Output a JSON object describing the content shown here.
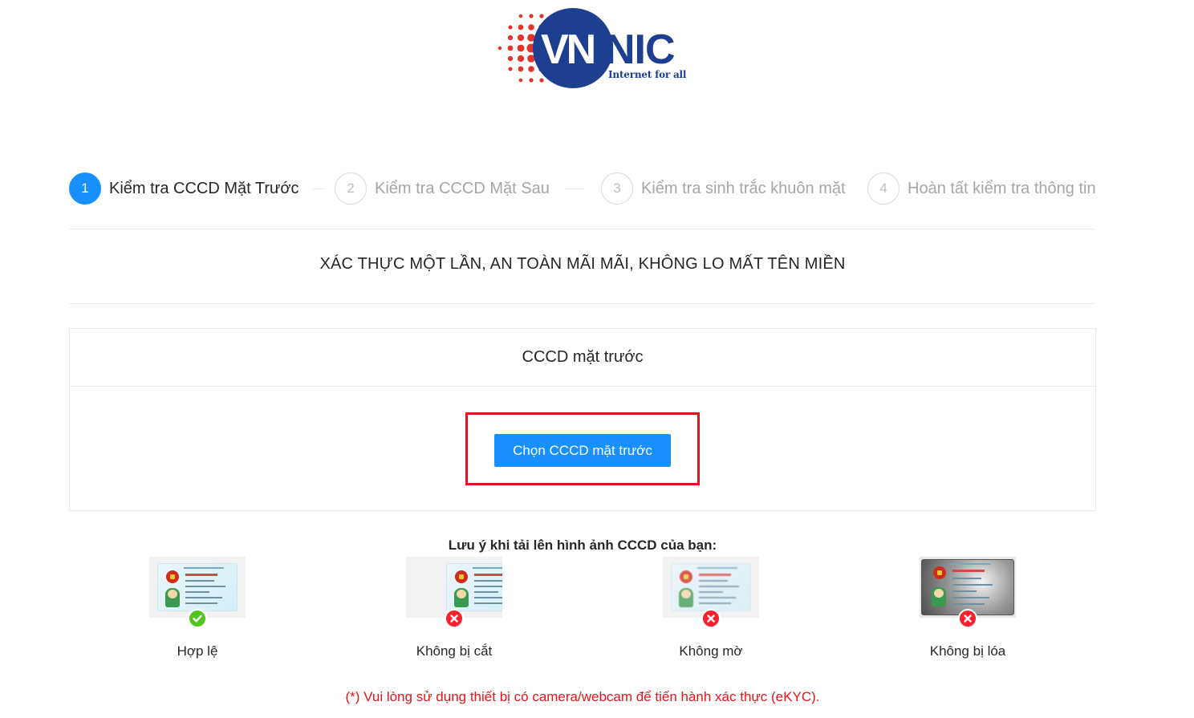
{
  "logo": {
    "brand_vn": "VN",
    "brand_nic": "NIC",
    "tagline": "Internet for all",
    "colors": {
      "blue": "#1c3f8f",
      "red": "#e5332a"
    }
  },
  "steps": [
    {
      "number": "1",
      "title": "Kiểm tra CCCD Mặt Trước",
      "status": "active"
    },
    {
      "number": "2",
      "title": "Kiểm tra CCCD Mặt Sau",
      "status": "waiting"
    },
    {
      "number": "3",
      "title": "Kiểm tra sinh trắc khuôn mặt",
      "status": "waiting"
    },
    {
      "number": "4",
      "title": "Hoàn tất kiểm tra thông tin",
      "status": "waiting"
    }
  ],
  "slogan": "XÁC THỰC MỘT LẦN, AN TOÀN MÃI MÃI, KHÔNG LO MẤT TÊN MIỀN",
  "upload_card": {
    "title": "CCCD mặt trước",
    "button_label": "Chọn CCCD mặt trước"
  },
  "notes": {
    "title": "Lưu ý khi tải lên hình ảnh CCCD của bạn:",
    "samples": [
      {
        "label": "Hợp lệ",
        "status": "valid",
        "icon": "check-circle-icon"
      },
      {
        "label": "Không bị cắt",
        "status": "invalid",
        "icon": "close-circle-icon"
      },
      {
        "label": "Không mờ",
        "status": "invalid",
        "icon": "close-circle-icon"
      },
      {
        "label": "Không bị lóa",
        "status": "invalid",
        "icon": "close-circle-icon"
      }
    ]
  },
  "footnote": "(*) Vui lòng sử dụng thiết bị có camera/webcam để tiến hành xác thực (eKYC).",
  "colors": {
    "primary": "#1890ff",
    "highlight_border": "#e0141e",
    "success": "#52c41a",
    "error": "#f5222d",
    "footnote": "#e8141c"
  }
}
